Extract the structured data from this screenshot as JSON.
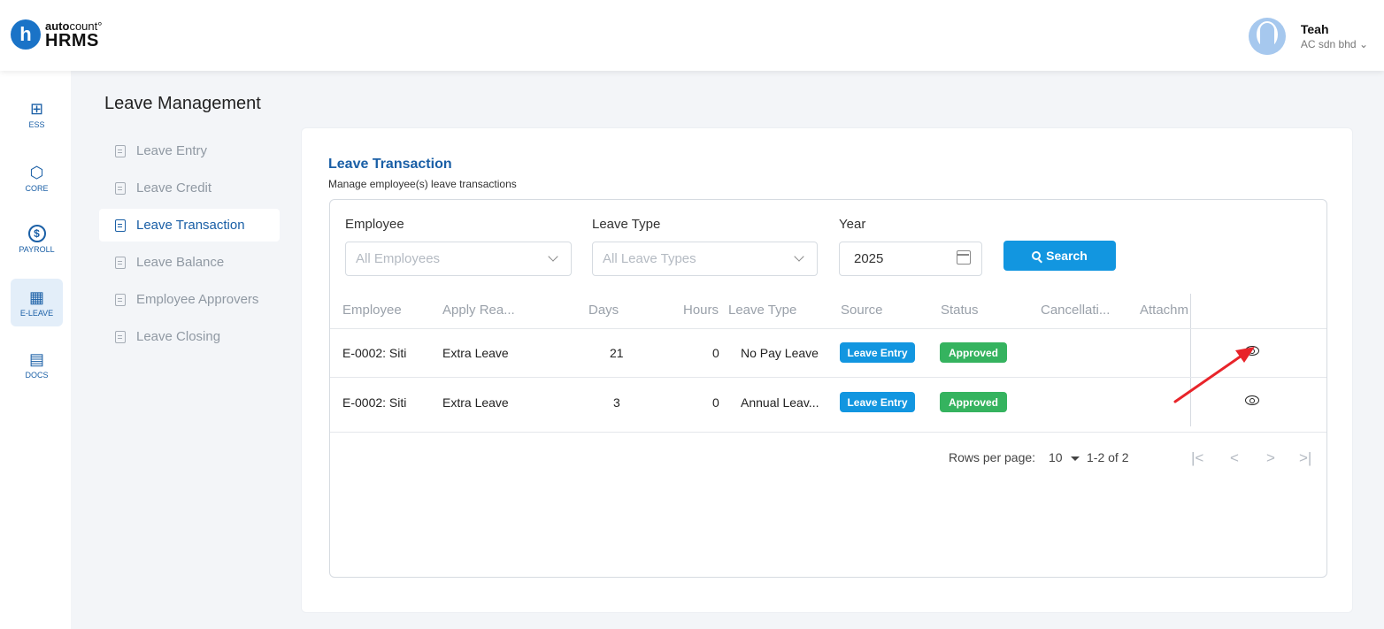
{
  "brand": {
    "badge": "h",
    "small_bold": "auto",
    "small_rest": "count",
    "small_mark": "°",
    "big": "HRMS"
  },
  "user": {
    "name": "Teah",
    "company": "AC sdn bhd",
    "company_caret": "⌄"
  },
  "rail": [
    {
      "label": "ESS",
      "icon": "⊞"
    },
    {
      "label": "CORE",
      "icon": "⬡"
    },
    {
      "label": "PAYROLL",
      "icon": "$"
    },
    {
      "label": "E-LEAVE",
      "icon": "▦"
    },
    {
      "label": "DOCS",
      "icon": "▤"
    }
  ],
  "section_title": "Leave Management",
  "subnav": [
    {
      "label": "Leave Entry"
    },
    {
      "label": "Leave Credit"
    },
    {
      "label": "Leave Transaction"
    },
    {
      "label": "Leave Balance"
    },
    {
      "label": "Employee Approvers"
    },
    {
      "label": "Leave Closing"
    }
  ],
  "page": {
    "title": "Leave Transaction",
    "subtitle": "Manage employee(s) leave transactions"
  },
  "filters": {
    "employee_label": "Employee",
    "employee_placeholder": "All Employees",
    "leave_type_label": "Leave Type",
    "leave_type_placeholder": "All Leave Types",
    "year_label": "Year",
    "year_value": "2025",
    "search_label": "Search"
  },
  "table": {
    "columns": [
      "Employee",
      "Apply Rea...",
      "Days",
      "Hours",
      "Leave Type",
      "Source",
      "Status",
      "Cancellati...",
      "Attachm"
    ],
    "rows": [
      {
        "employee": "E-0002: Siti",
        "reason": "Extra Leave",
        "days": "21",
        "hours": "0",
        "leave_type": "No Pay Leave",
        "source": "Leave Entry",
        "status": "Approved"
      },
      {
        "employee": "E-0002: Siti",
        "reason": "Extra Leave",
        "days": "3",
        "hours": "0",
        "leave_type": "Annual Leav...",
        "source": "Leave Entry",
        "status": "Approved"
      }
    ]
  },
  "pagination": {
    "rows_per_page_label": "Rows per page:",
    "rows_per_page": "10",
    "range": "1-2 of 2",
    "first": "|<",
    "prev": "<",
    "next": ">",
    "last": ">|"
  },
  "colors": {
    "primary": "#1a5fa6",
    "button": "#1296e0",
    "approved": "#35b35f",
    "annotation_arrow": "#e8242a"
  }
}
